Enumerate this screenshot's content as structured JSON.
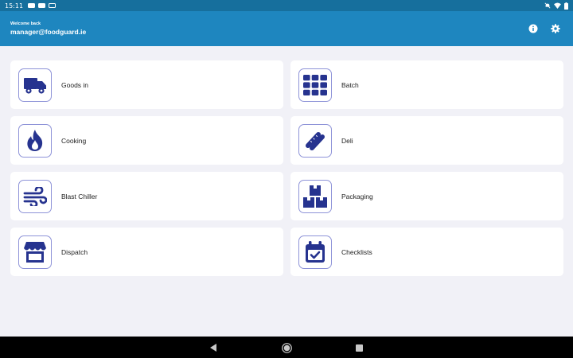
{
  "status_bar": {
    "time": "15:11",
    "notification_icons": [
      "youtube-icon",
      "youtube-icon",
      "gmail-icon"
    ],
    "system_icons": [
      "mute-icon",
      "wifi-icon",
      "battery-icon"
    ]
  },
  "header": {
    "greeting": "Welcome back",
    "email": "manager@foodguard.ie",
    "actions": [
      "info-icon",
      "settings-icon"
    ]
  },
  "menu": [
    {
      "label": "Goods in",
      "icon": "truck-icon"
    },
    {
      "label": "Batch",
      "icon": "grid-icon"
    },
    {
      "label": "Cooking",
      "icon": "flame-icon"
    },
    {
      "label": "Deli",
      "icon": "sausage-icon"
    },
    {
      "label": "Blast Chiller",
      "icon": "wind-icon"
    },
    {
      "label": "Packaging",
      "icon": "boxes-icon"
    },
    {
      "label": "Dispatch",
      "icon": "store-icon"
    },
    {
      "label": "Checklists",
      "icon": "calendar-check-icon"
    }
  ],
  "colors": {
    "status_bar": "#166f9d",
    "app_bar": "#1e86bf",
    "background": "#f1f1f7",
    "icon_fill": "#26338f",
    "icon_border": "#8e93d8"
  },
  "nav_bar": [
    "back-icon",
    "home-icon",
    "recent-apps-icon"
  ]
}
